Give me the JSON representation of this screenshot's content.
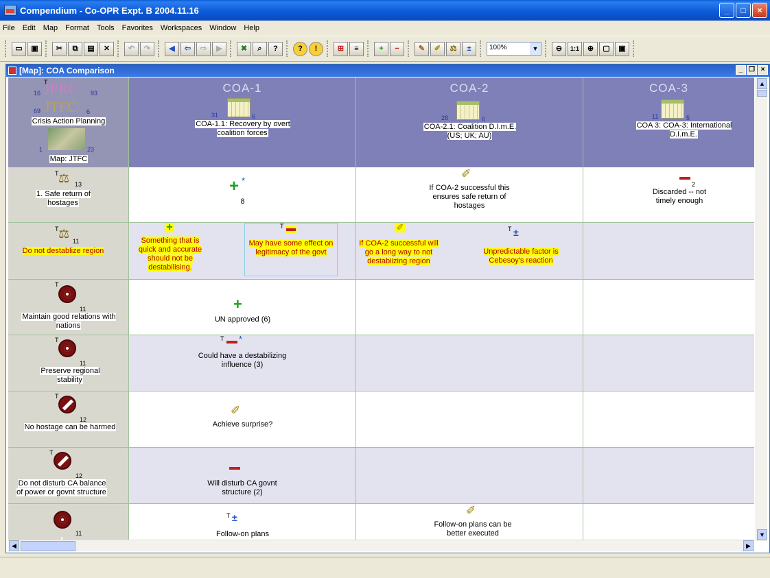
{
  "window": {
    "title": "Compendium - Co-OPR Expt. B 2004.11.16"
  },
  "menu": [
    "File",
    "Edit",
    "Map",
    "Format",
    "Tools",
    "Favorites",
    "Workspaces",
    "Window",
    "Help"
  ],
  "toolbar": {
    "zoom_value": "100%",
    "zoom_one_to_one": "1:1"
  },
  "map_window": {
    "title": "[Map]: COA Comparison"
  },
  "header": {
    "col0": {
      "logo_top": "JPRC",
      "logo_top_left_num": "16",
      "logo_top_right_num": "93",
      "logo_mid": "JTFC",
      "logo_mid_left_num": "69",
      "logo_mid_right_num": "6",
      "label1": "Crisis Action Planning",
      "map_left_num": "1",
      "map_right_num": "23",
      "label2": "Map: JTFC"
    },
    "col1": {
      "title": "COA-1",
      "num_left": "31",
      "num_right": "6",
      "label": "COA-1.1: Recovery by overt coalition forces"
    },
    "col2": {
      "title": "COA-2",
      "num_left": "28",
      "num_right": "6",
      "label": "COA-2.1: Coalition D.I.m.E. (US; UK; AU)"
    },
    "col3": {
      "title": "COA-3",
      "num_left": "11",
      "num_right": "5",
      "label": "COA 3: COA-3: International  D.I.m.E."
    }
  },
  "rows": [
    {
      "criterion": "1. Safe return of hostages",
      "num": "13",
      "c1_value": "8",
      "c2_text": "If COA-2 successful this ensures safe return of hostages",
      "c3_text": "Discarded -- not timely enough",
      "c3_num": "2"
    },
    {
      "criterion": "Do not destablize region",
      "num": "11",
      "c1a": "Something that is quick and accurate should not be destabilising.",
      "c1b": "May have some effect on legitimacy of the govt",
      "c2a": "If COA-2 successful will go a long way to not destabiizing region",
      "c2b": "Unpredictable factor is Cebesoy's reaction"
    },
    {
      "criterion": "Maintain good relations with nations",
      "num": "11",
      "c1_text": "UN approved (6)"
    },
    {
      "criterion": "Preserve regional stability",
      "num": "11",
      "c1_text": "Could have a destabilizing influence (3)"
    },
    {
      "criterion": "No hostage can be harmed",
      "num": "12",
      "c1_text": "Achieve surprise?"
    },
    {
      "criterion": "Do not disturb CA balance of power or govnt structure",
      "num": "12",
      "c1_text": "Will disturb CA govnt structure (2)"
    },
    {
      "criterion": "",
      "num": "11",
      "c1_text": "Follow-on plans",
      "c2_text": "Follow-on plans can be better executed"
    }
  ],
  "markers": {
    "tag": "T",
    "star": "*"
  },
  "colors": {
    "titlebar": "#0a5fd8",
    "header_bg": "#8080b8",
    "highlight": "#ffff00",
    "highlight_text": "#b00000",
    "grid_line": "#9fc39a"
  }
}
